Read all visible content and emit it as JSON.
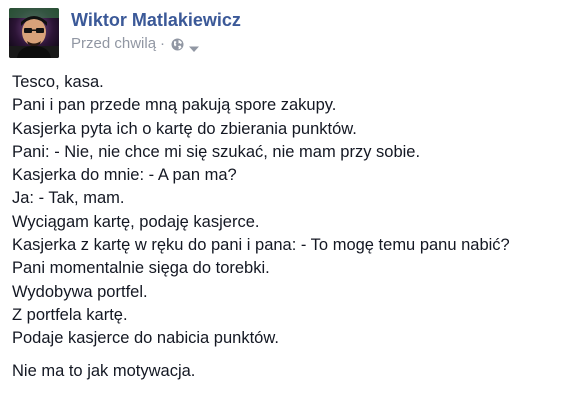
{
  "post": {
    "author": "Wiktor Matlakiewicz",
    "timestamp": "Przed chwilą",
    "separator": "·",
    "privacy_icon": "globe-icon",
    "menu_icon": "caret-down-icon",
    "paragraphs": [
      {
        "lines": [
          "Tesco, kasa.",
          "Pani i pan przede mną pakują spore zakupy.",
          "Kasjerka pyta ich o kartę do zbierania punktów.",
          "Pani: - Nie, nie chce mi się szukać, nie mam przy sobie.",
          "Kasjerka do mnie: - A pan ma?",
          "Ja: - Tak, mam.",
          "Wyciągam kartę, podaję kasjerce.",
          "Kasjerka z kartę w ręku do pani i pana: - To mogę temu panu nabić?",
          "Pani momentalnie sięga do torebki.",
          "Wydobywa portfel.",
          "Z portfela kartę.",
          "Podaje kasjerce do nabicia punktów."
        ]
      },
      {
        "lines": [
          "Nie ma to jak motywacja."
        ]
      }
    ]
  },
  "colors": {
    "author": "#3b5998",
    "meta": "#9197a3",
    "text": "#141823",
    "background": "#ffffff"
  }
}
